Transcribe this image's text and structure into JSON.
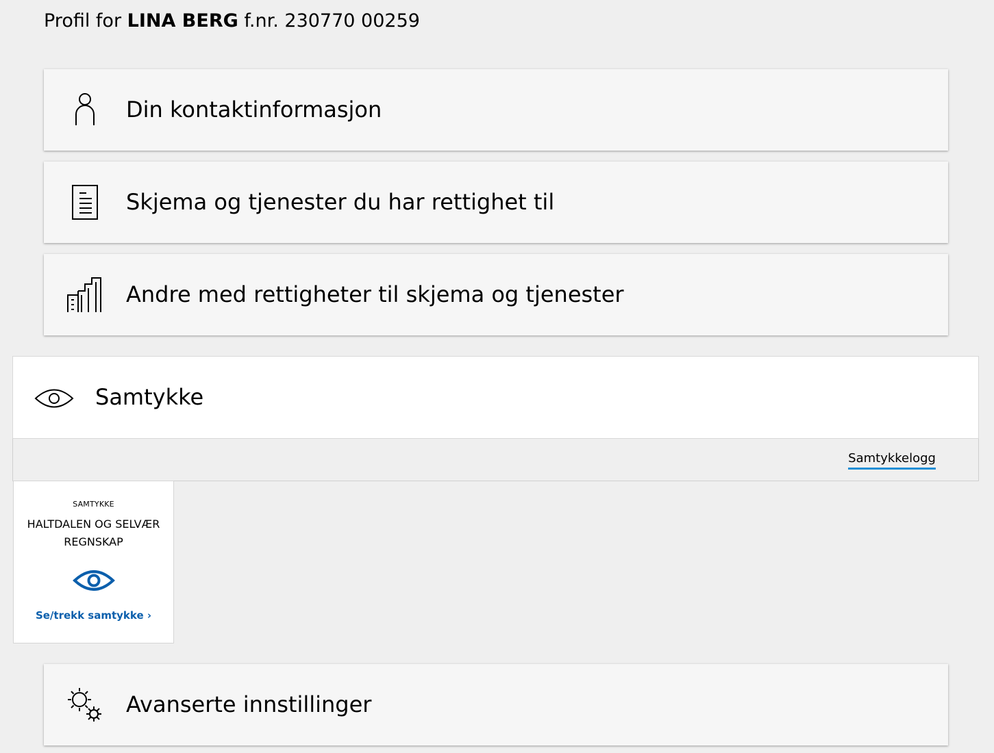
{
  "profile": {
    "prefix": "Profil for",
    "name": "LINA BERG",
    "id_label": "f.nr. 230770 00259"
  },
  "sections": {
    "contact": {
      "label": "Din kontaktinformasjon",
      "icon": "person-icon"
    },
    "forms": {
      "label": "Skjema og tjenester du har rettighet til",
      "icon": "document-icon"
    },
    "others": {
      "label": "Andre med rettigheter til skjema og tjenester",
      "icon": "buildings-icon"
    },
    "consent": {
      "label": "Samtykke",
      "icon": "eye-icon",
      "log_link": "Samtykkelogg",
      "tile": {
        "type": "SAMTYKKE",
        "org_line1": "HALTDALEN OG SELVÆR",
        "org_line2": "REGNSKAP",
        "icon": "eye-icon",
        "action": "Se/trekk samtykke ›",
        "accent_color": "#0b5fac"
      }
    },
    "advanced": {
      "label": "Avanserte innstillinger",
      "icon": "gears-icon"
    }
  },
  "colors": {
    "background": "#efefef",
    "card": "#f6f6f6",
    "link_underline": "#1e8fd6",
    "link": "#0b5fac"
  }
}
